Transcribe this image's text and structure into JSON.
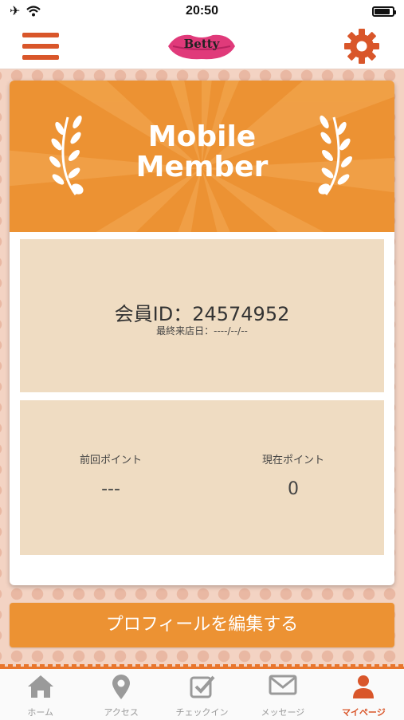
{
  "status_bar": {
    "time": "20:50"
  },
  "app_bar": {
    "logo_text": "Betty",
    "menu_icon": "hamburger-menu-icon",
    "settings_icon": "gear-icon"
  },
  "member_card": {
    "title_line1": "Mobile",
    "title_line2": "Member",
    "member_id": "会員ID：24574952",
    "last_visit": "最終来店日：----/--/--",
    "points": {
      "previous_label": "前回ポイント",
      "previous_value": "---",
      "current_label": "現在ポイント",
      "current_value": "0"
    }
  },
  "edit_profile_button": "プロフィールを編集する",
  "tabs": [
    {
      "label": "ホーム",
      "icon": "home-icon",
      "active": false
    },
    {
      "label": "アクセス",
      "icon": "map-pin-icon",
      "active": false
    },
    {
      "label": "チェックイン",
      "icon": "checkbox-icon",
      "active": false
    },
    {
      "label": "メッセージ",
      "icon": "envelope-icon",
      "active": false
    },
    {
      "label": "マイページ",
      "icon": "user-icon",
      "active": true
    }
  ],
  "colors": {
    "accent_orange": "#ec9233",
    "icon_red": "#d9562a",
    "panel_beige": "#efdcc2",
    "logo_pink": "#e03a7a"
  }
}
